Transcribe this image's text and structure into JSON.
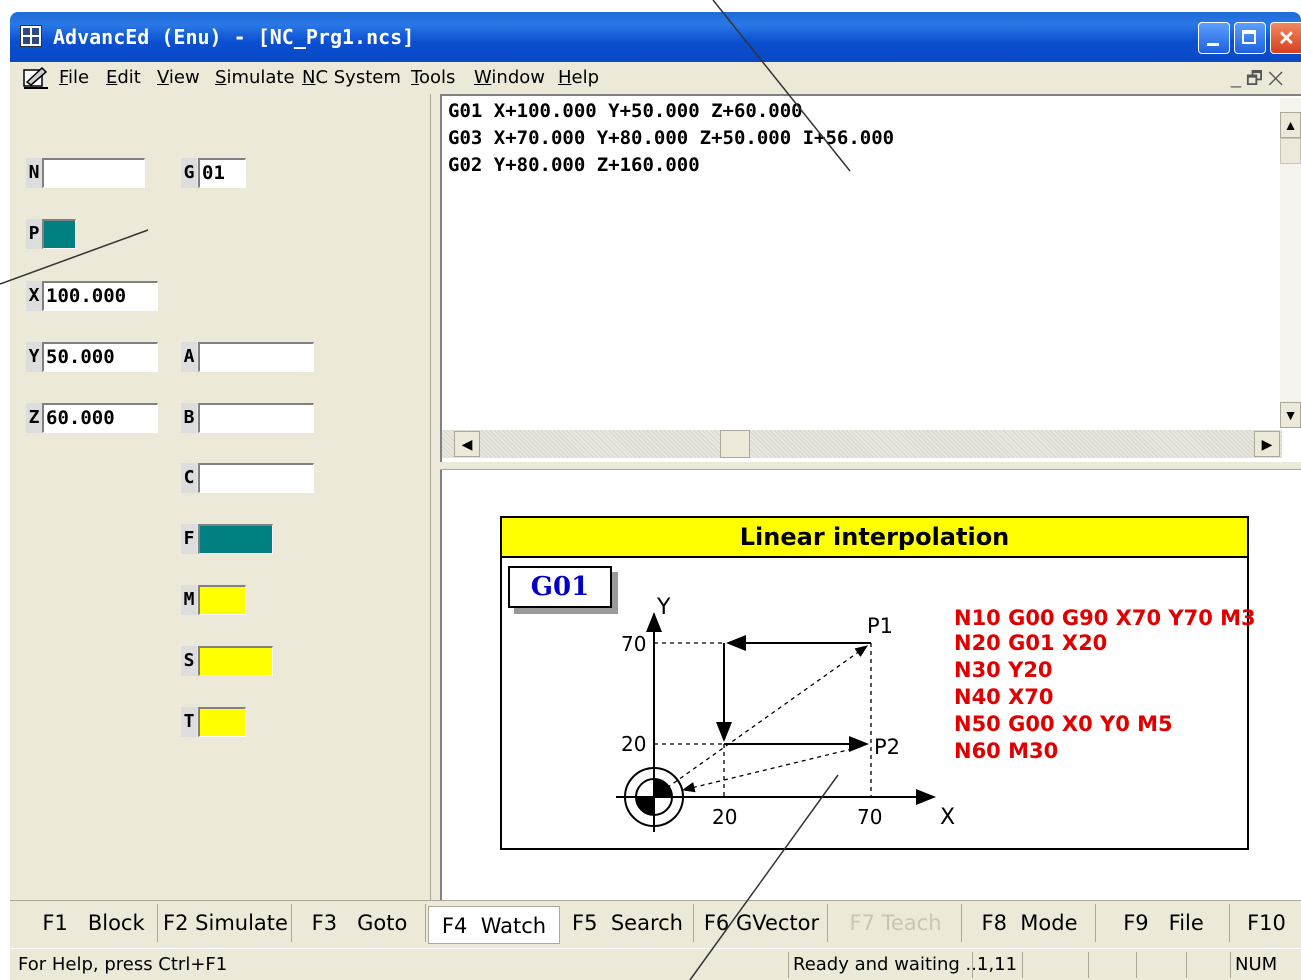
{
  "window": {
    "title": "AdvancEd (Enu) - [NC_Prg1.ncs]",
    "min_label": "minimize",
    "max_label": "maximize",
    "close_label": "close"
  },
  "menu": {
    "items": [
      "File",
      "Edit",
      "View",
      "Simulate",
      "NC System",
      "Tools",
      "Window",
      "Help"
    ],
    "mdi_controls": "_ 🗗 ✕"
  },
  "fields": {
    "N": {
      "label": "N",
      "value": ""
    },
    "G": {
      "label": "G",
      "value": "01"
    },
    "P": {
      "label": "P",
      "value": ""
    },
    "X": {
      "label": "X",
      "value": "100.000"
    },
    "Y": {
      "label": "Y",
      "value": "50.000"
    },
    "A": {
      "label": "A",
      "value": ""
    },
    "Z": {
      "label": "Z",
      "value": "60.000"
    },
    "B": {
      "label": "B",
      "value": ""
    },
    "C": {
      "label": "C",
      "value": ""
    },
    "F": {
      "label": "F",
      "value": ""
    },
    "M": {
      "label": "M",
      "value": ""
    },
    "S": {
      "label": "S",
      "value": ""
    },
    "T": {
      "label": "T",
      "value": ""
    }
  },
  "editor": {
    "lines": [
      "G01 X+100.000 Y+50.000 Z+60.000",
      "G03 X+70.000 Y+80.000 Z+50.000 I+56.000",
      "G02 Y+80.000 Z+160.000"
    ]
  },
  "diagram": {
    "title": "Linear interpolation",
    "gcode": "G01",
    "axis_x": "X",
    "axis_y": "Y",
    "tick_x": [
      "20",
      "70"
    ],
    "tick_y": [
      "70",
      "20"
    ],
    "points": [
      "P1",
      "P2"
    ],
    "program": [
      "N10 G00 G90 X70 Y70 M3",
      "N20 G01 X20",
      "N30 Y20",
      "N40 X70",
      "N50 G00 X0 Y0 M5",
      "N60 M30"
    ],
    "colors": {
      "header": "#ffff00",
      "program": "#e00000",
      "gcode": "#0000c8"
    }
  },
  "fkeys": [
    {
      "label": "F1   Block"
    },
    {
      "label": "F2 Simulate"
    },
    {
      "label": "F3   Goto"
    },
    {
      "label": "F4  Watch"
    },
    {
      "label": "F5  Search"
    },
    {
      "label": "F6 GVector"
    },
    {
      "label": "F7 Teach"
    },
    {
      "label": "F8  Mode"
    },
    {
      "label": "F9   File"
    },
    {
      "label": "F10"
    }
  ],
  "status": {
    "help": "For Help, press Ctrl+F1",
    "state": "Ready and waiting ...",
    "position": "1,11",
    "num": "NUM"
  }
}
